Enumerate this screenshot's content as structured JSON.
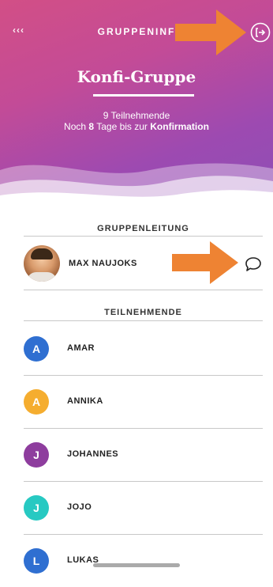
{
  "header": {
    "back_label": "‹‹‹",
    "title": "GRUPPENINF",
    "group_name": "Konfi-Gruppe",
    "participant_count_text": "9 Teilnehmende",
    "days_prefix": "Noch",
    "days_number": "8",
    "days_middle": "Tage bis zur",
    "days_event": "Konfirmation",
    "logout_icon": "logout-icon"
  },
  "sections": {
    "leadership_title": "GRUPPENLEITUNG",
    "participants_title": "TEILNEHMENDE"
  },
  "leader": {
    "name": "MAX NAUJOKS",
    "chat_icon": "chat-bubble-icon"
  },
  "members": [
    {
      "initial": "A",
      "name": "AMAR",
      "color": "#2f6fd1"
    },
    {
      "initial": "A",
      "name": "ANNIKA",
      "color": "#f5ad2f"
    },
    {
      "initial": "J",
      "name": "JOHANNES",
      "color": "#8e3d9e"
    },
    {
      "initial": "J",
      "name": "JOJO",
      "color": "#27c9c2"
    },
    {
      "initial": "L",
      "name": "LUKAS",
      "color": "#2f6fd1"
    }
  ],
  "colors": {
    "header_gradient_start": "#d24f86",
    "header_gradient_end": "#8c4fb6",
    "annotation_arrow": "#ee8333"
  }
}
